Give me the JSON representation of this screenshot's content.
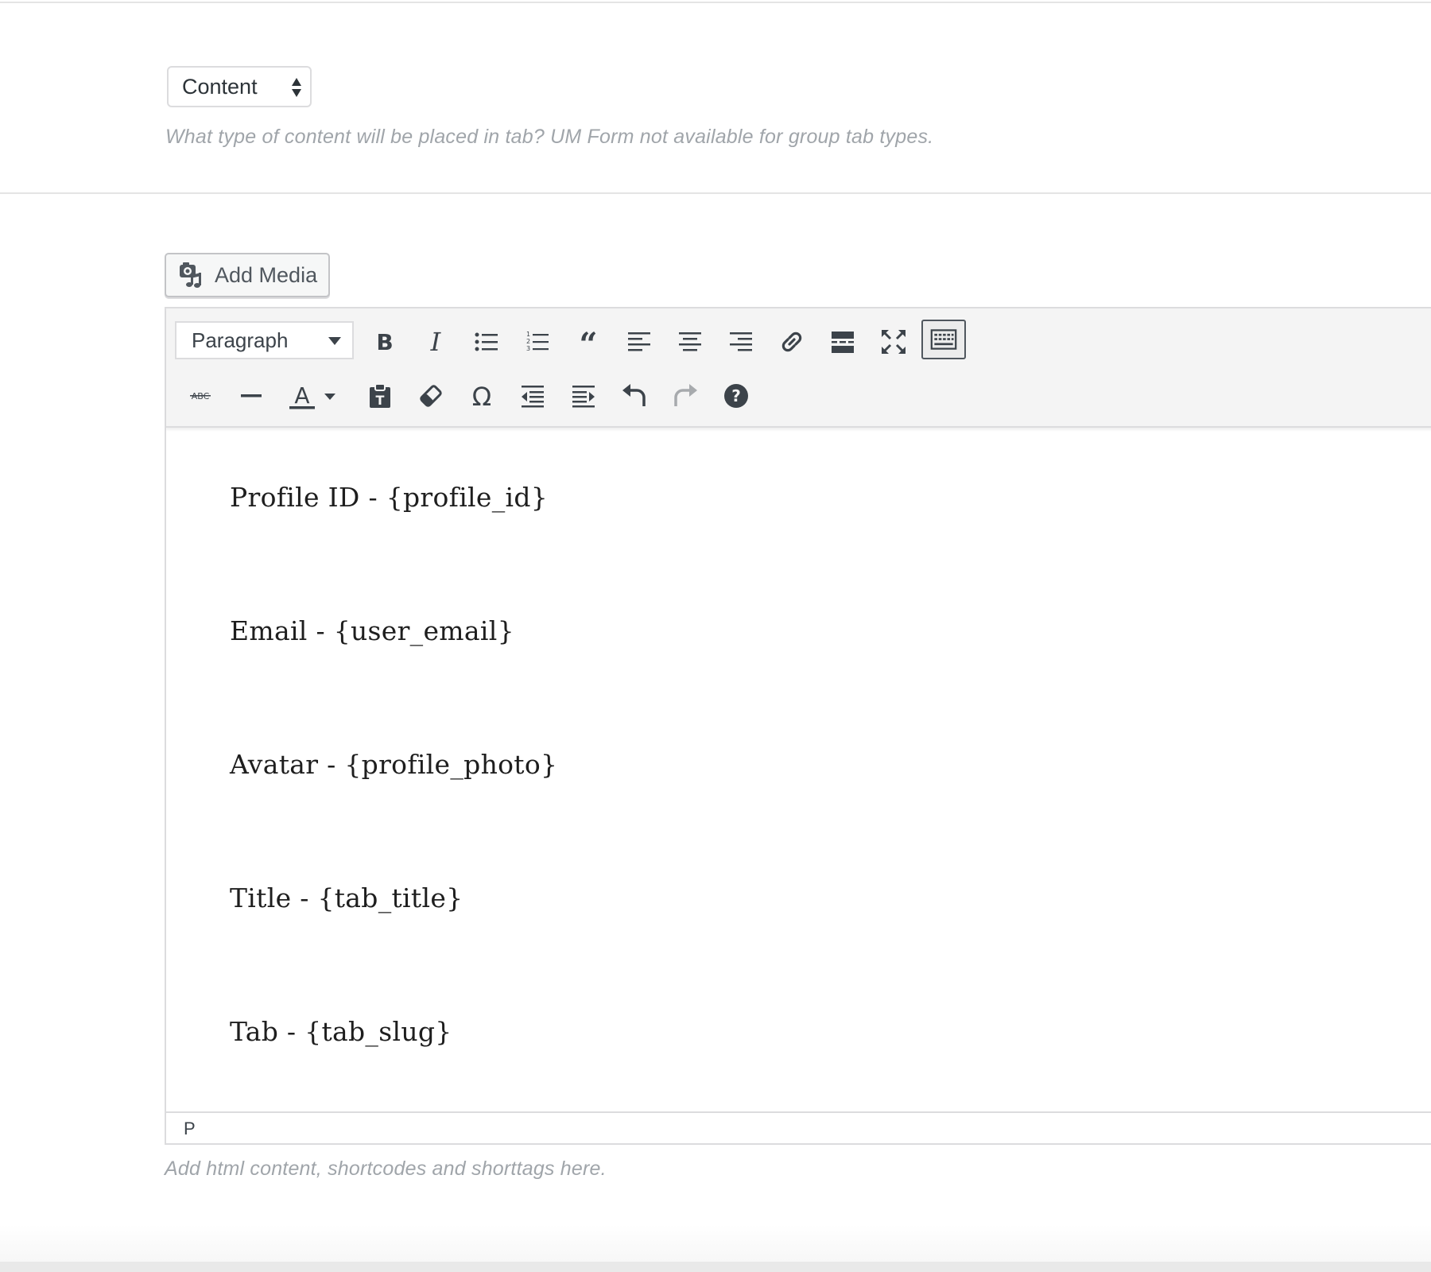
{
  "content_type": {
    "selected": "Content",
    "hint": "What type of content will be placed in tab? UM Form not available for group tab types."
  },
  "media": {
    "add_media_label": "Add Media"
  },
  "editor": {
    "format_select": "Paragraph",
    "toolbar_row1": [
      "bold-icon",
      "italic-icon",
      "bulleted-list-icon",
      "numbered-list-icon",
      "blockquote-icon",
      "align-left-icon",
      "align-center-icon",
      "align-right-icon",
      "insert-link-icon",
      "read-more-icon",
      "fullscreen-icon",
      "toolbar-toggle-icon"
    ],
    "toolbar_row2": [
      "strikethrough-icon",
      "horizontal-line-icon",
      "text-color-icon",
      "paste-as-text-icon",
      "clear-formatting-icon",
      "special-character-icon",
      "outdent-icon",
      "indent-icon",
      "undo-icon",
      "redo-icon",
      "help-icon"
    ],
    "text_color_glyph": "A",
    "strike_glyph": "ABC",
    "paragraphs": [
      "Profile ID - {profile_id}",
      "Email - {user_email}",
      "Avatar - {profile_photo}",
      "Title - {tab_title}",
      "Tab - {tab_slug}"
    ],
    "path": "P",
    "hint": "Add html content, shortcodes and shorttags here."
  }
}
